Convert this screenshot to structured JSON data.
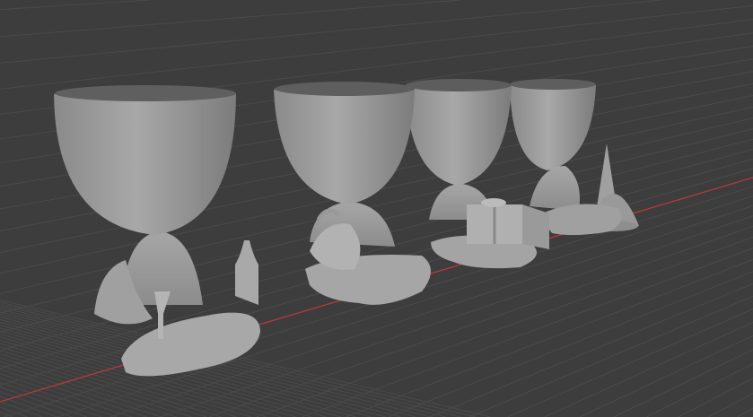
{
  "viewport": {
    "background_color": "#3d3d3d",
    "grid_color": "#4a4a4a",
    "x_axis_color": "#b5393f",
    "model_color": "#a3a3a3",
    "models": [
      "pot-figure-wine",
      "pot-figure-bell",
      "pot-figure-gift",
      "pot-figure-tree"
    ]
  }
}
